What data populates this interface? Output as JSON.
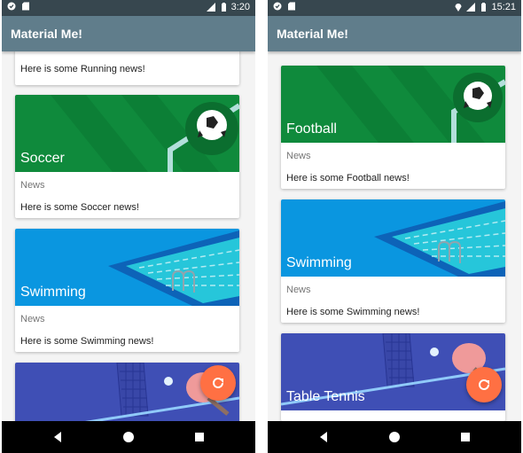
{
  "app": {
    "title": "Material Me!"
  },
  "left": {
    "status_time": "3:20",
    "cards": [
      {
        "info": "Here is some Running news!"
      },
      {
        "title": "Soccer",
        "subtitle": "News",
        "info": "Here is some Soccer news!"
      },
      {
        "title": "Swimming",
        "subtitle": "News",
        "info": "Here is some Swimming news!"
      },
      {
        "title": "",
        "subtitle": "",
        "info": ""
      }
    ]
  },
  "right": {
    "status_time": "15:21",
    "cards": [
      {
        "title": "Football",
        "subtitle": "News",
        "info": "Here is some Football news!"
      },
      {
        "title": "Swimming",
        "subtitle": "News",
        "info": "Here is some Swimming news!"
      },
      {
        "title": "Table Tennis",
        "subtitle": "",
        "info": ""
      }
    ]
  },
  "fab": {
    "icon": "refresh-icon"
  },
  "nav": {
    "back_icon": "back-triangle-icon",
    "home_icon": "home-circle-icon",
    "recent_icon": "recents-square-icon"
  },
  "colors": {
    "appbar": "#607d8b",
    "statusbar": "#37474f",
    "fab": "#ff7043",
    "soccer_green": "#0f8a3c",
    "swimming_blue": "#0a96e0",
    "tabletennis_indigo": "#3f4fb5"
  }
}
